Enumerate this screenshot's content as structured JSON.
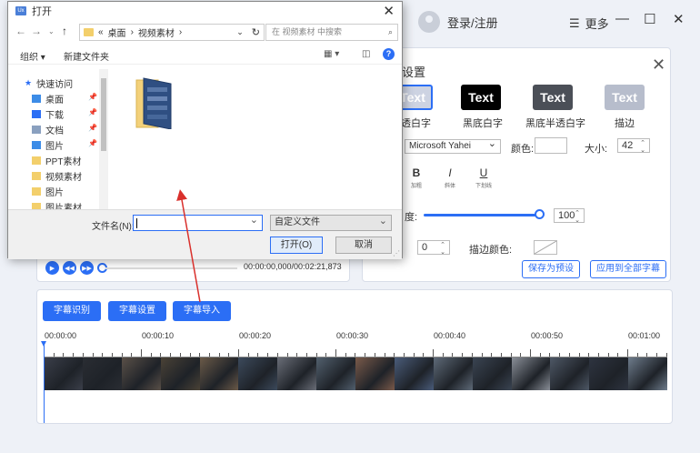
{
  "titlebar": {
    "login_label": "登录/注册",
    "more_label": "更多",
    "menu_icon": "hamburger-icon",
    "minimize_glyph": "—",
    "maximize_glyph": "☐",
    "close_glyph": "✕"
  },
  "subtitle_settings": {
    "title": "设置",
    "close_glyph": "✕",
    "styles": [
      {
        "text": "Text",
        "label": "透白字",
        "bg": "#cdd3e2",
        "fg": "#ffffff"
      },
      {
        "text": "Text",
        "label": "黑底白字",
        "bg": "#000000",
        "fg": "#ffffff"
      },
      {
        "text": "Text",
        "label": "黑底半透白字",
        "bg": "#4b4f57",
        "fg": "#ffffff"
      },
      {
        "text": "Text",
        "label": "描边",
        "bg": "#b7bdcc",
        "fg": "#ffffff"
      }
    ],
    "font_value": "Microsoft Yahei",
    "color_label": "颜色:",
    "size_label": "大小:",
    "size_value": "42",
    "format": [
      {
        "glyph": "B",
        "caption": "加粗"
      },
      {
        "glyph": "I",
        "caption": "斜体"
      },
      {
        "glyph": "U",
        "caption": "下划线"
      }
    ],
    "opacity_label": "度:",
    "opacity_value": "100",
    "opacity_level": 1.0,
    "stroke_value": "0",
    "stroke_color_label": "描边颜色:",
    "save_preset_label": "保存为预设",
    "apply_all_label": "应用到全部字幕"
  },
  "player": {
    "time_readout": "00:00:00,000/00:02:21,873",
    "progress": 0.0
  },
  "timeline": {
    "tabs": [
      "字幕识别",
      "字幕设置",
      "字幕导入"
    ],
    "ticks": [
      "00:00:00",
      "00:00:10",
      "00:00:20",
      "00:00:30",
      "00:00:40",
      "00:00:50",
      "00:01:00"
    ]
  },
  "dialog": {
    "title": "打开",
    "app_icon_text": "Ux",
    "breadcrumb": [
      "«",
      "桌面",
      "›",
      "视频素材",
      "›"
    ],
    "search_placeholder": "在 视频素材 中搜索",
    "toolbar_organize": "组织 ▾",
    "toolbar_new_folder": "新建文件夹",
    "help_glyph": "?",
    "nav_items": [
      {
        "label": "快速访问",
        "icon": "star-icon",
        "color": "#2b6ef5"
      },
      {
        "label": "桌面",
        "icon": "desktop-icon",
        "color": "#3c8ce7",
        "pinned": true
      },
      {
        "label": "下载",
        "icon": "download-icon",
        "color": "#2b6ef5",
        "pinned": true
      },
      {
        "label": "文档",
        "icon": "document-icon",
        "color": "#8aa0bf",
        "pinned": true
      },
      {
        "label": "图片",
        "icon": "picture-icon",
        "color": "#3c8ce7",
        "pinned": true
      },
      {
        "label": "PPT素材",
        "icon": "folder-icon",
        "color": "#f3cf6b"
      },
      {
        "label": "视频素材",
        "icon": "folder-icon",
        "color": "#f3cf6b"
      },
      {
        "label": "图片",
        "icon": "folder-icon",
        "color": "#f3cf6b"
      },
      {
        "label": "图片素材",
        "icon": "folder-icon",
        "color": "#f3cf6b"
      }
    ],
    "filename_label": "文件名(N):",
    "filename_value": "",
    "filetype_value": "自定义文件",
    "open_label": "打开(O)",
    "cancel_label": "取消"
  },
  "colors": {
    "accent": "#2b6ef5",
    "annotation_arrow": "#d9302c"
  }
}
